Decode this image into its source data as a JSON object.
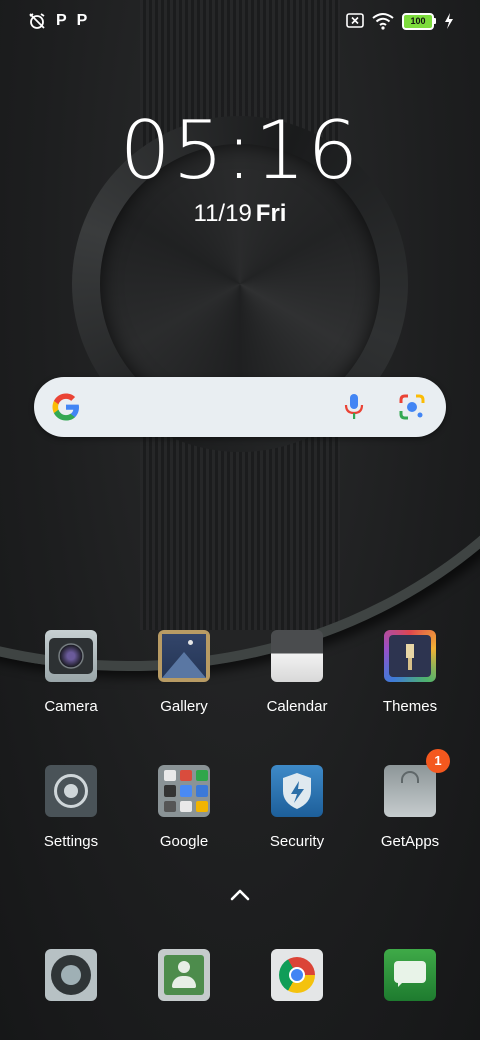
{
  "status_bar": {
    "left_icons": [
      "alarm-off-icon",
      "p-icon",
      "p-icon"
    ],
    "p_glyph": "P",
    "battery_level": "100",
    "right_icons": [
      "no-sim-icon",
      "wifi-icon",
      "battery-icon",
      "charging-icon"
    ]
  },
  "clock": {
    "time": "05:16",
    "date_md": "11/19",
    "date_dow": "Fri"
  },
  "search": {
    "icons": [
      "google-g-icon",
      "mic-icon",
      "google-lens-icon"
    ]
  },
  "apps": [
    {
      "label": "Camera",
      "icon": "camera-icon"
    },
    {
      "label": "Gallery",
      "icon": "gallery-icon"
    },
    {
      "label": "Calendar",
      "icon": "calendar-icon"
    },
    {
      "label": "Themes",
      "icon": "themes-icon"
    },
    {
      "label": "Settings",
      "icon": "settings-icon"
    },
    {
      "label": "Google",
      "icon": "google-folder-icon"
    },
    {
      "label": "Security",
      "icon": "security-icon"
    },
    {
      "label": "GetApps",
      "icon": "getapps-icon",
      "badge": "1"
    }
  ],
  "dock": [
    "phone-icon",
    "contacts-icon",
    "chrome-icon",
    "messages-icon"
  ],
  "colors": {
    "badge": "#f4581e",
    "battery": "#7ddc3c",
    "search_bg": "#e9eef2"
  }
}
